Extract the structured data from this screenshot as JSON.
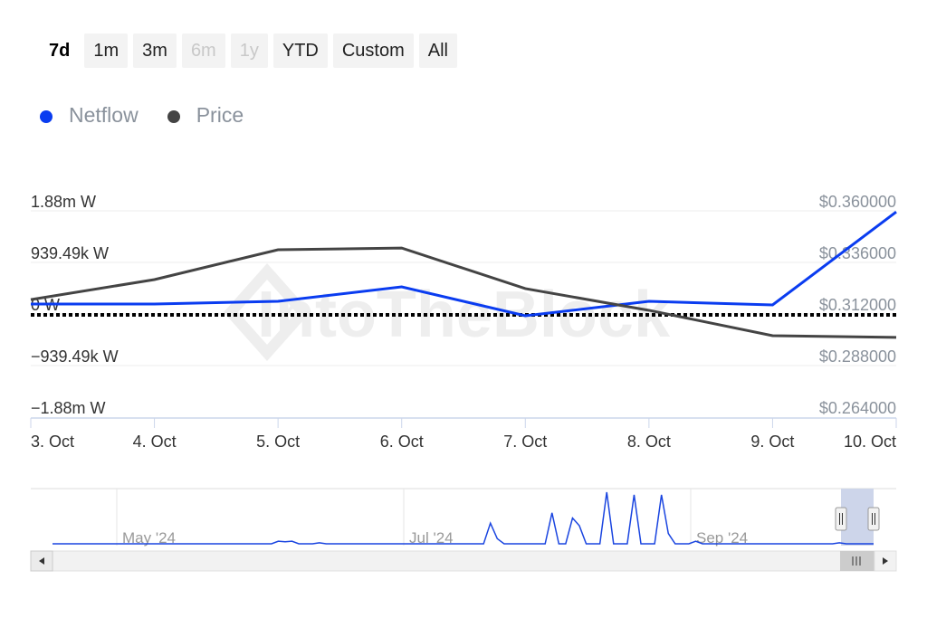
{
  "range_selector": {
    "buttons": [
      {
        "label": "7d",
        "state": "selected"
      },
      {
        "label": "1m",
        "state": "normal"
      },
      {
        "label": "3m",
        "state": "normal"
      },
      {
        "label": "6m",
        "state": "disabled"
      },
      {
        "label": "1y",
        "state": "disabled"
      },
      {
        "label": "YTD",
        "state": "normal"
      },
      {
        "label": "Custom",
        "state": "normal"
      },
      {
        "label": "All",
        "state": "normal"
      }
    ]
  },
  "watermark": "IntoTheBlock",
  "chart_data": {
    "type": "line",
    "categories": [
      "3. Oct",
      "4. Oct",
      "5. Oct",
      "6. Oct",
      "7. Oct",
      "8. Oct",
      "9. Oct",
      "10. Oct"
    ],
    "series": [
      {
        "name": "Netflow",
        "color": "#0a3cf0",
        "axis": "left",
        "values": [
          181000,
          181000,
          231000,
          494000,
          -33000,
          231000,
          165000,
          1860000
        ]
      },
      {
        "name": "Price",
        "color": "#444444",
        "axis": "right",
        "values": [
          0.3187,
          0.328,
          0.3419,
          0.3427,
          0.3238,
          0.3137,
          0.3019,
          0.3011
        ]
      }
    ],
    "left_axis": {
      "ticks": [
        1880000,
        939490,
        0,
        -939490,
        -1880000
      ],
      "tick_labels": [
        "1.88m W",
        "939.49k W",
        "0 W",
        "−939.49k W",
        "−1.88m W"
      ],
      "range": [
        -1880000,
        1880000
      ]
    },
    "right_axis": {
      "ticks": [
        0.36,
        0.336,
        0.312,
        0.288,
        0.264
      ],
      "tick_labels": [
        "$0.360000",
        "$0.336000",
        "$0.312000",
        "$0.288000",
        "$0.264000"
      ],
      "range": [
        0.264,
        0.36
      ]
    },
    "zero_line": "dotted",
    "grid": true,
    "legend_placement": "top-left",
    "navigator": {
      "labels": [
        "May '24",
        "Jul '24",
        "Sep '24"
      ],
      "values": [
        0,
        0,
        0,
        0,
        0,
        0,
        0,
        0,
        0,
        0,
        0,
        0,
        0,
        0,
        0,
        0,
        0,
        0,
        0,
        0,
        0,
        0,
        0,
        0,
        0,
        0,
        0,
        0,
        0,
        0,
        0,
        0,
        0,
        0.05,
        0.04,
        0.05,
        0,
        0,
        0,
        0.02,
        0,
        0,
        0,
        0,
        0,
        0,
        0,
        0,
        0,
        0,
        0,
        0,
        0,
        0,
        0,
        0,
        0,
        0,
        0,
        0,
        0,
        0,
        0,
        0,
        0.4,
        0.1,
        0,
        0,
        0,
        0,
        0,
        0,
        0,
        0.6,
        0,
        0,
        0.5,
        0.35,
        0,
        0,
        0,
        1,
        0,
        0,
        0,
        0.95,
        0,
        0,
        0,
        0.95,
        0.2,
        0,
        0,
        0,
        0.05,
        0,
        0,
        0,
        0,
        0,
        0,
        0,
        0,
        0,
        0,
        0,
        0,
        0,
        0,
        0,
        0,
        0,
        0,
        0,
        0,
        0.02,
        0,
        0,
        0,
        0,
        0
      ]
    }
  }
}
